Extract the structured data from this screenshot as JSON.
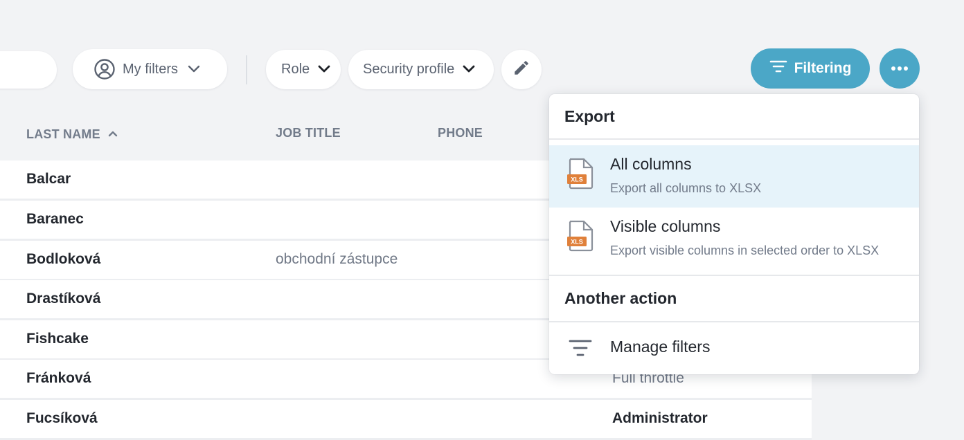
{
  "toolbar": {
    "my_filters_label": "My filters",
    "role_label": "Role",
    "security_profile_label": "Security profile",
    "filtering_label": "Filtering"
  },
  "table": {
    "columns": [
      "LAST NAME",
      "JOB TITLE",
      "PHONE"
    ],
    "sort_column": "LAST NAME",
    "sort_direction": "ascending",
    "rows": [
      {
        "last_name": "Balcar",
        "job_title": "",
        "role": ""
      },
      {
        "last_name": "Baranec",
        "job_title": "",
        "role": ""
      },
      {
        "last_name": "Bodloková",
        "job_title": "obchodní zástupce",
        "role": ""
      },
      {
        "last_name": "Drastíková",
        "job_title": "",
        "role": ""
      },
      {
        "last_name": "Fishcake",
        "job_title": "",
        "role": ""
      },
      {
        "last_name": "Fránková",
        "job_title": "",
        "role": "Full throttle"
      },
      {
        "last_name": "Fucsíková",
        "job_title": "",
        "role": "Administrator"
      }
    ]
  },
  "menu": {
    "export_heading": "Export",
    "items": [
      {
        "title": "All columns",
        "subtitle": "Export all columns to XLSX",
        "icon": "xls-file-icon"
      },
      {
        "title": "Visible columns",
        "subtitle": "Export visible columns in selected order to XLSX",
        "icon": "xls-file-icon"
      }
    ],
    "icon_badge": "XLS",
    "another_heading": "Another action",
    "manage_filters_label": "Manage filters"
  },
  "colors": {
    "accent": "#4ba7c7",
    "background": "#f2f3f5",
    "active_item": "#e6f3fa",
    "xls_badge": "#e0803a"
  }
}
